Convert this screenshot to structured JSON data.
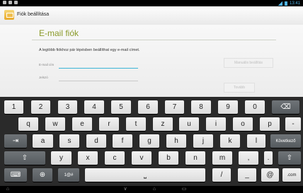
{
  "app": {
    "title": "Fiók beállítása"
  },
  "status": {
    "time": "13:41"
  },
  "form": {
    "heading": "E-mail fiók",
    "description": "A legtöbb fiókhoz pár lépésben beállíthat egy e-mail címet.",
    "email_label": "E-mail cím",
    "password_label": "Jelszó",
    "manual_button": "Manuális beállítás",
    "next_button": "Tovább"
  },
  "keyboard": {
    "row1": [
      "1",
      "2",
      "3",
      "4",
      "5",
      "6",
      "7",
      "8",
      "9",
      "0"
    ],
    "row2": [
      "q",
      "w",
      "e",
      "r",
      "t",
      "z",
      "u",
      "i",
      "o",
      "p",
      "-"
    ],
    "row3": [
      "a",
      "s",
      "d",
      "f",
      "g",
      "h",
      "j",
      "k",
      "l"
    ],
    "next_key": "Következő",
    "row4": [
      "y",
      "x",
      "c",
      "v",
      "b",
      "n",
      "m",
      ",",
      "."
    ],
    "symbols_key": "1@#",
    "slash_key": "/",
    "underscore_key": "_",
    "at_key": "@",
    "dotcom_key": ".com",
    "backspace_icon": "⌫",
    "shift_icon": "⇧",
    "tab_icon": "⇥",
    "keyboard_icon": "⌨",
    "globe_icon": "⊕",
    "space_icon": "⎵"
  },
  "nav": {
    "back_icon": "⌂",
    "down_icon": "∨",
    "home_icon": "⌂",
    "recent_icon": "▭"
  }
}
